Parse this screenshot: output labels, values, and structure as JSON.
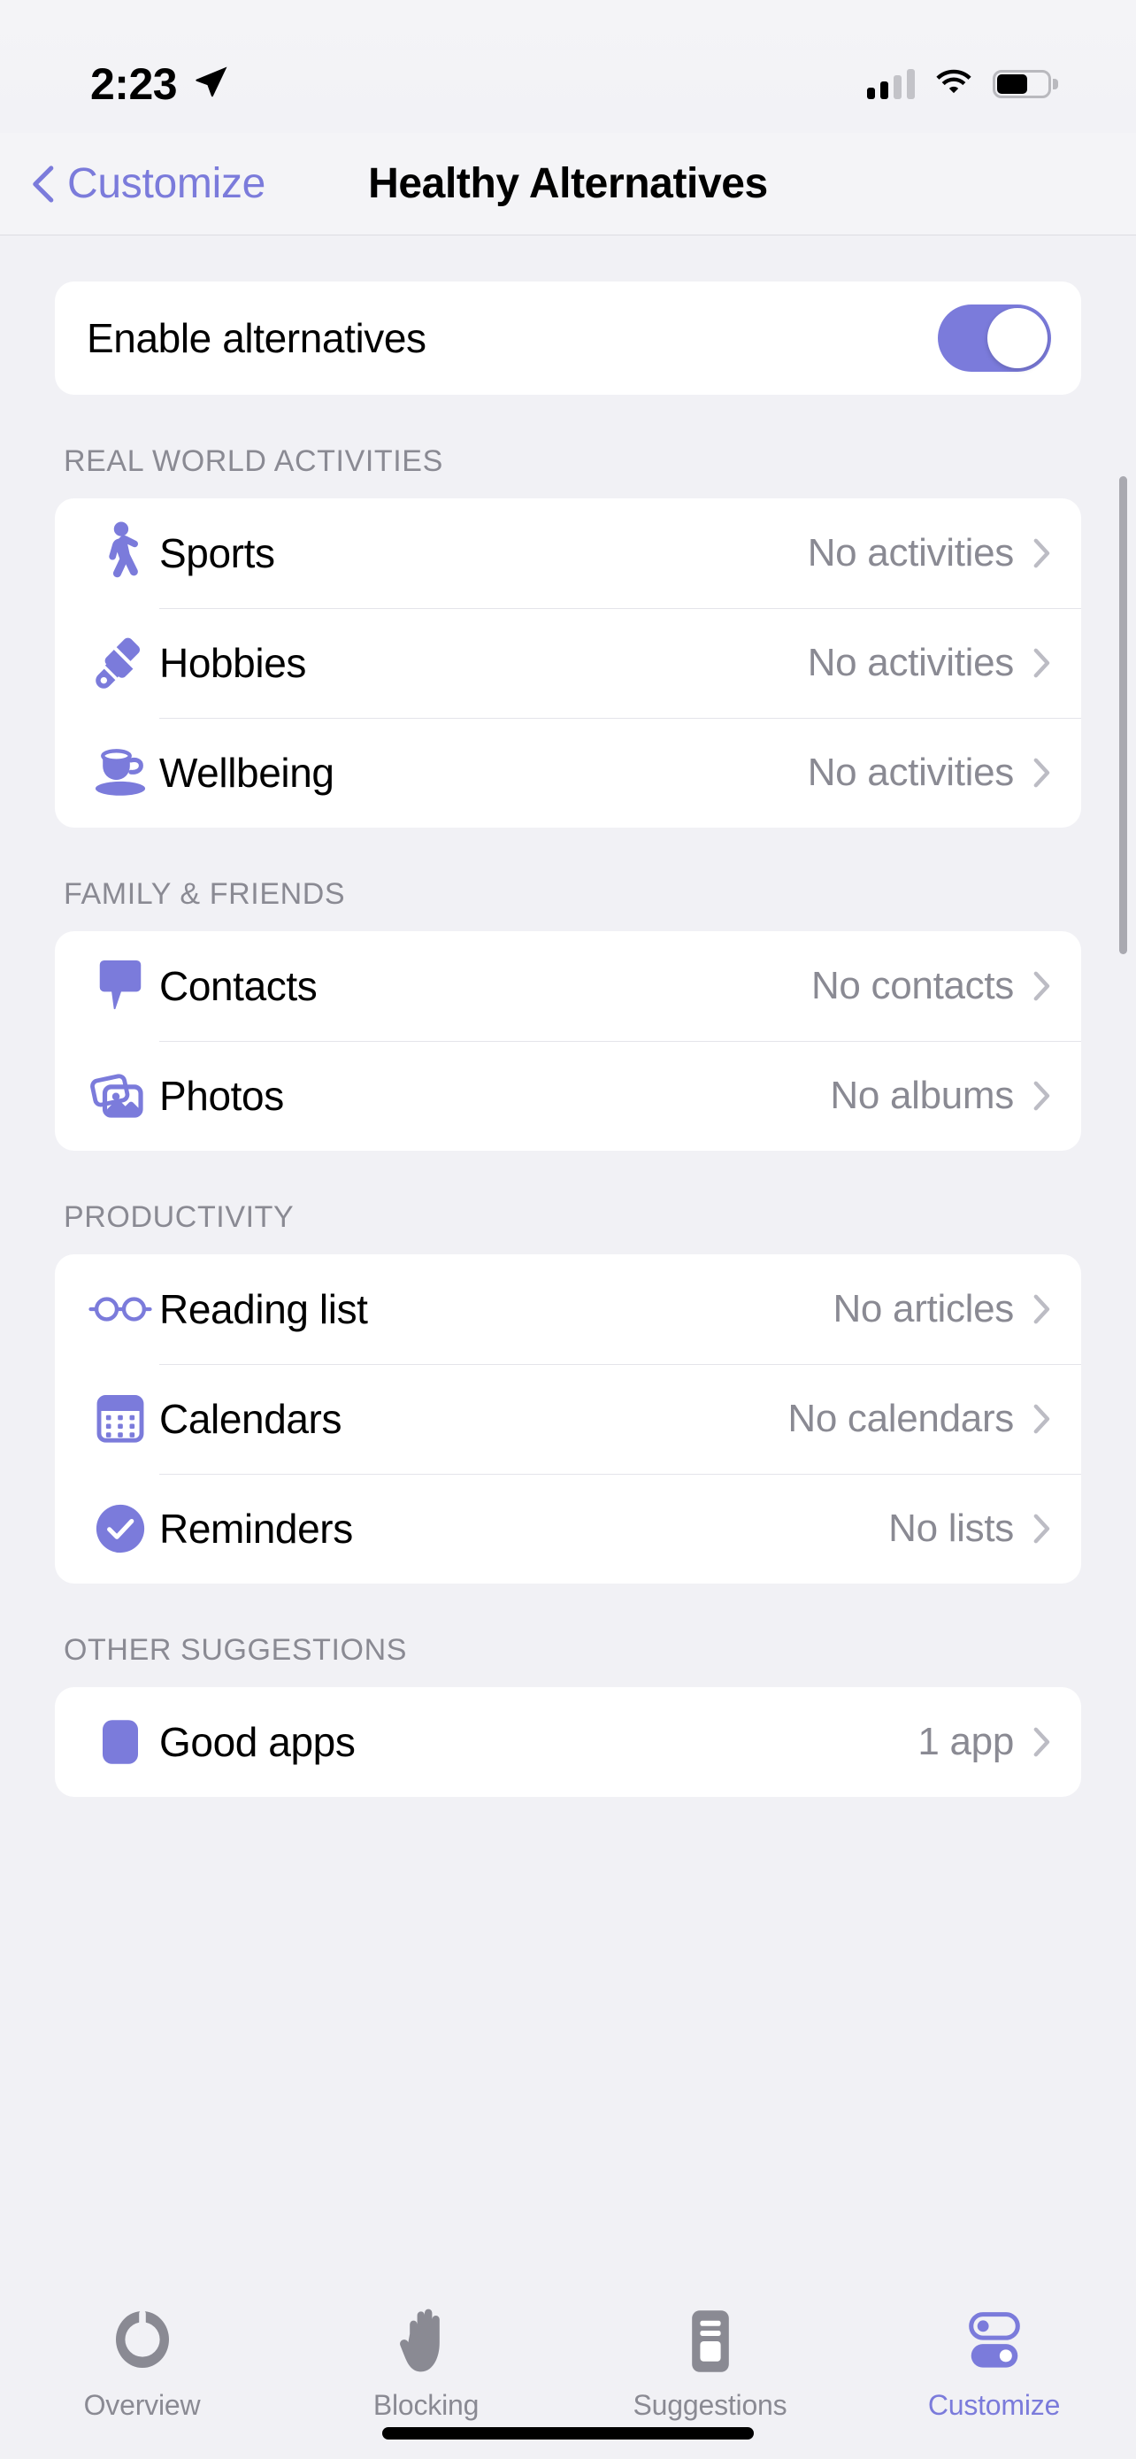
{
  "theme": {
    "accent": "#7b7bdb",
    "background": "#f1f1f5",
    "card": "#ffffff",
    "secondary_text": "#8a8a93",
    "primary_text": "#000000"
  },
  "status_bar": {
    "time": "2:23",
    "location_icon": "location-arrow-icon",
    "cellular_icon": "cellular-signal-icon",
    "cellular_bars_filled": 2,
    "cellular_bars_total": 4,
    "wifi_icon": "wifi-icon",
    "battery_icon": "battery-icon",
    "battery_level_percent": 52
  },
  "nav": {
    "back_icon": "chevron-left-icon",
    "back_label": "Customize",
    "title": "Healthy Alternatives"
  },
  "toggle_row": {
    "label": "Enable alternatives",
    "icon": "toggle-switch",
    "enabled": true
  },
  "sections": [
    {
      "header": "REAL WORLD ACTIVITIES",
      "rows": [
        {
          "icon": "walking-person-icon",
          "label": "Sports",
          "value": "No activities"
        },
        {
          "icon": "paintbrush-icon",
          "label": "Hobbies",
          "value": "No activities"
        },
        {
          "icon": "teacup-icon",
          "label": "Wellbeing",
          "value": "No activities"
        }
      ]
    },
    {
      "header": "FAMILY & FRIENDS",
      "rows": [
        {
          "icon": "speech-bubble-icon",
          "label": "Contacts",
          "value": "No contacts"
        },
        {
          "icon": "photo-stack-icon",
          "label": "Photos",
          "value": "No albums"
        }
      ]
    },
    {
      "header": "PRODUCTIVITY",
      "rows": [
        {
          "icon": "glasses-icon",
          "label": "Reading list",
          "value": "No articles"
        },
        {
          "icon": "calendar-icon",
          "label": "Calendars",
          "value": "No calendars"
        },
        {
          "icon": "check-circle-icon",
          "label": "Reminders",
          "value": "No lists"
        }
      ]
    },
    {
      "header": "OTHER SUGGESTIONS",
      "rows": [
        {
          "icon": "app-square-icon",
          "label": "Good apps",
          "value": "1 app"
        }
      ]
    }
  ],
  "tabbar": {
    "tabs": [
      {
        "icon": "gauge-icon",
        "label": "Overview",
        "active": false
      },
      {
        "icon": "hand-icon",
        "label": "Blocking",
        "active": false
      },
      {
        "icon": "card-list-icon",
        "label": "Suggestions",
        "active": false
      },
      {
        "icon": "sliders-icon",
        "label": "Customize",
        "active": true
      }
    ]
  },
  "chevron_icon": "chevron-right-icon",
  "home_indicator": "home-indicator"
}
